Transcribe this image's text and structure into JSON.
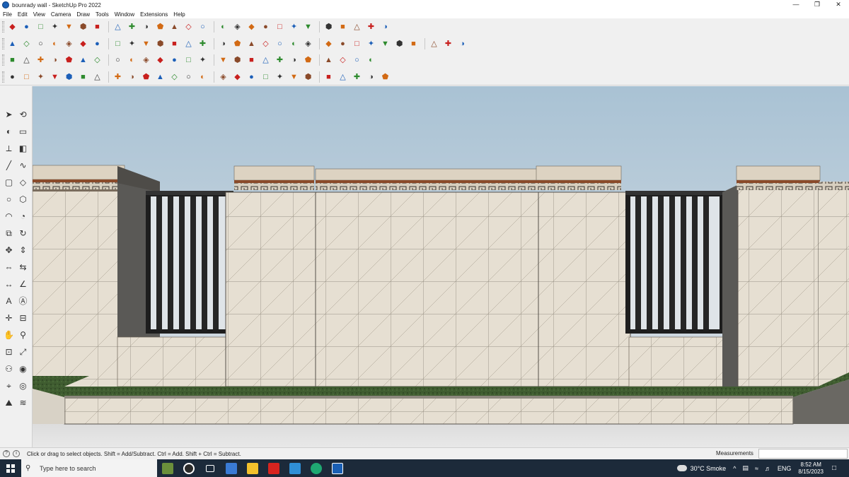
{
  "window": {
    "title": "bounrady wall - SketchUp Pro 2022",
    "controls": {
      "minimize": "—",
      "restore": "❐",
      "close": "✕"
    }
  },
  "menu": [
    "File",
    "Edit",
    "View",
    "Camera",
    "Draw",
    "Tools",
    "Window",
    "Extensions",
    "Help"
  ],
  "toolbar_rows": [
    [
      "search-icon",
      "select-arrow-icon",
      "eraser-icon",
      "pencil-icon",
      "paint-icon",
      "push-pull-icon",
      "move-icon",
      "rotate-icon",
      "scale-icon",
      "offset-icon",
      "tape-measure-icon",
      "text-icon",
      "paint-bucket-icon",
      "orbit-icon",
      "pan-icon",
      "zoom-icon",
      "zoom-extents-icon",
      "section-icon",
      "layers-icon",
      "sandbox-icon",
      "components-icon",
      "warehouse-icon",
      "extension-icon",
      "undo-icon",
      "redo-icon",
      "share-icon"
    ],
    [
      "box-icon",
      "cube-iso-icon",
      "cube-top-icon",
      "arrow-down-icon",
      "intersect-icon",
      "cube-front-icon",
      "cube-right-icon",
      "cube-back-icon",
      "cube-left-icon",
      "camera-icon",
      "follow-me-icon",
      "outer-shell-icon",
      "solid-icon",
      "house-icon",
      "union-icon",
      "subtract-icon",
      "trim-icon",
      "split-icon",
      "loft-icon",
      "sweep-icon",
      "shape-icon",
      "circle-icon",
      "ellipse-icon",
      "arc-icon",
      "polygon-icon",
      "chain-icon",
      "curve-icon",
      "spline-icon",
      "fillet-icon",
      "chamfer-icon",
      "extrude-icon"
    ],
    [
      "shape-3d-icon",
      "gear-icon",
      "arc-tool-icon",
      "rect-tool-icon",
      "frame-icon",
      "cylinder-icon",
      "cone-icon",
      "sphere-icon",
      "torus-icon",
      "pyramid-icon",
      "prism-icon",
      "dome-icon",
      "helix-icon",
      "grid-icon",
      "array-icon",
      "mirror-icon",
      "align-icon",
      "distribute-icon",
      "bend-icon",
      "twist-icon",
      "taper-icon",
      "shell-icon",
      "thicken-icon",
      "weld-icon",
      "explode-icon"
    ],
    [
      "plugin-a-icon",
      "plugin-b-icon",
      "plugin-c-icon",
      "plugin-d-icon",
      "plugin-e-icon",
      "plugin-f-icon",
      "plugin-g-icon",
      "plugin-h-icon",
      "plugin-i-icon",
      "plugin-j-icon",
      "plugin-k-icon",
      "plugin-l-icon",
      "plugin-m-icon",
      "plugin-n-icon",
      "plugin-o-icon",
      "plugin-p-icon",
      "plugin-q-icon",
      "plugin-r-icon",
      "plugin-s-icon",
      "plugin-t-icon",
      "plugin-u-icon",
      "plugin-v-icon",
      "plugin-w-icon",
      "plugin-x-icon",
      "plugin-y-icon",
      "plugin-z-icon"
    ]
  ],
  "left_tools": [
    "select-icon",
    "orbit-icon",
    "paint-bucket-icon",
    "eraser-icon",
    "tape-icon",
    "push-icon",
    "line-icon",
    "freehand-icon",
    "rectangle-icon",
    "rotated-rect-icon",
    "circle-icon",
    "polygon-icon",
    "arc-icon",
    "pie-icon",
    "offset-icon",
    "follow-me-icon",
    "rotate-icon",
    "move-icon",
    "scale-icon",
    "flip-icon",
    "dimension-icon",
    "protractor-icon",
    "text-icon",
    "3d-text-icon",
    "axes-icon",
    "section-plane-icon",
    "pan-icon",
    "zoom-icon",
    "zoom-window-icon",
    "zoom-extents-icon",
    "walk-icon",
    "look-around-icon",
    "position-camera-icon",
    "section-icon",
    "sandbox-icon",
    "layers-icon"
  ],
  "status": {
    "hint": "Click or drag to select objects. Shift = Add/Subtract. Ctrl = Add. Shift + Ctrl = Subtract.",
    "measurements_label": "Measurements",
    "measurements_value": ""
  },
  "taskbar": {
    "search_placeholder": "Type here to search",
    "apps": [
      "minecraft-icon",
      "cortana-icon",
      "task-view-icon",
      "calculator-icon",
      "file-explorer-icon",
      "adobe-icon",
      "store-icon",
      "edge-icon",
      "sketchup-icon"
    ],
    "weather": "30°C  Smoke",
    "language": "ENG",
    "time": "8:52 AM",
    "date": "8/15/2023"
  },
  "colors": {
    "wall_face": "#e4ddd0",
    "pillar_dark": "#5a5956",
    "grass": "#3d5a2f",
    "cornice": "#8a4a2a",
    "taskbar": "#1c2a3a"
  }
}
